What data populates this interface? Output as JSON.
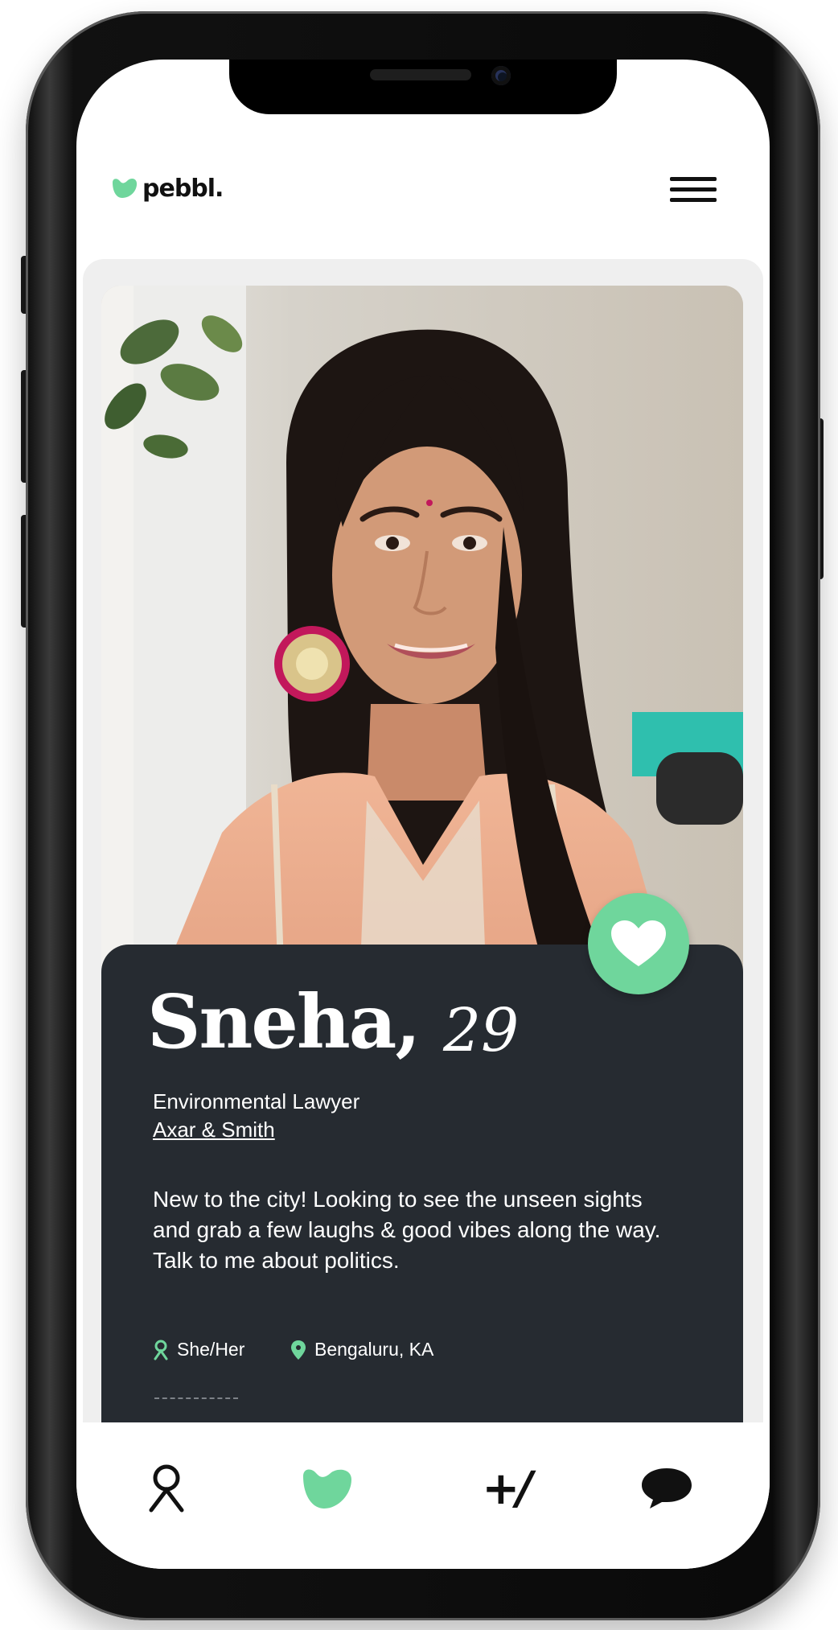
{
  "app": {
    "brand": "pebbl."
  },
  "profile": {
    "name": "Sneha,",
    "age": "29",
    "job_title": "Environmental Lawyer",
    "company": "Axar & Smith",
    "bio": "New to the city! Looking to see the unseen sights and grab a few laughs & good vibes along the way. Talk to me about politics.",
    "pronouns": "She/Her",
    "location": "Bengaluru, KA"
  },
  "nav": {
    "items": [
      {
        "icon": "profile-icon"
      },
      {
        "icon": "heart-pebble-icon",
        "active": true
      },
      {
        "icon": "plus-one-icon",
        "label": "+/"
      },
      {
        "icon": "chat-icon"
      }
    ]
  },
  "colors": {
    "accent": "#6fd69c",
    "card_bg": "#262b31",
    "card_wrap": "#efefef",
    "text_dark": "#111111"
  },
  "icons": {
    "menu": "hamburger-icon",
    "like": "heart-icon",
    "pronouns": "person-icon",
    "location": "location-pin-icon"
  }
}
